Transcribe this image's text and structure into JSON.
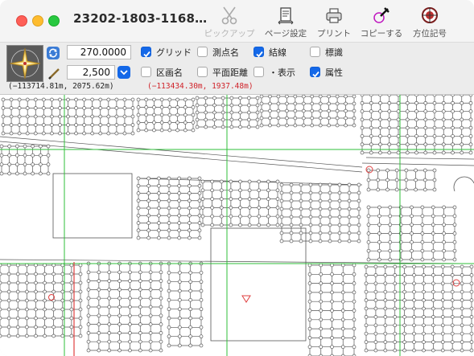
{
  "window": {
    "title": "23202-1803-1168…"
  },
  "toolbar": {
    "pickup_label": "ピックアップ",
    "page_setup_label": "ページ設定",
    "print_label": "プリント",
    "copy_label": "コピーする",
    "compass_label": "方位記号"
  },
  "controls": {
    "angle_value": "270.0000",
    "scale_value": "2,500",
    "options": [
      {
        "label": "グリッド",
        "checked": true
      },
      {
        "label": "測点名",
        "checked": false
      },
      {
        "label": "結線",
        "checked": true
      },
      {
        "label": "標識",
        "checked": false
      },
      {
        "label": "区画名",
        "checked": false
      },
      {
        "label": "平面距離",
        "checked": false
      },
      {
        "label": "・表示",
        "checked": false
      },
      {
        "label": "属性",
        "checked": true
      }
    ],
    "coord_left": "(−113714.81m,  2075.62m)",
    "coord_right": "(−113434.30m,  1937.48m)"
  },
  "colors": {
    "accent": "#1468e8",
    "grid_line": "#2fbf3a",
    "parcel_line": "#555555",
    "marker_red": "#e04040"
  }
}
